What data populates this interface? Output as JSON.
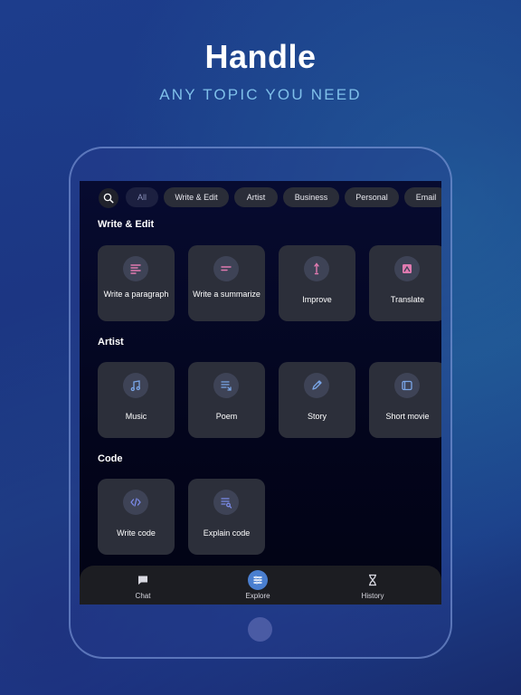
{
  "headline": "Handle",
  "subheadline": "ANY TOPIC YOU NEED",
  "chips": [
    "All",
    "Write & Edit",
    "Artist",
    "Business",
    "Personal",
    "Email"
  ],
  "sections": [
    {
      "title": "Write & Edit",
      "cards": [
        {
          "label": "Write a paragraph",
          "icon": "paragraph-icon"
        },
        {
          "label": "Write a summarize",
          "icon": "summary-icon"
        },
        {
          "label": "Improve",
          "icon": "pen-icon"
        },
        {
          "label": "Translate",
          "icon": "translate-icon"
        }
      ]
    },
    {
      "title": "Artist",
      "cards": [
        {
          "label": "Music",
          "icon": "music-icon"
        },
        {
          "label": "Poem",
          "icon": "poem-icon"
        },
        {
          "label": "Story",
          "icon": "pencil-icon"
        },
        {
          "label": "Short movie",
          "icon": "movie-icon"
        }
      ]
    },
    {
      "title": "Code",
      "cards": [
        {
          "label": "Write code",
          "icon": "code-icon"
        },
        {
          "label": "Explain code",
          "icon": "explain-icon"
        }
      ]
    }
  ],
  "nav": [
    {
      "label": "Chat",
      "icon": "chat-icon"
    },
    {
      "label": "Explore",
      "icon": "explore-icon",
      "active": true
    },
    {
      "label": "History",
      "icon": "hourglass-icon"
    }
  ],
  "colors": {
    "accent": "#4a7fd0",
    "icon_pink": "#e07ab0",
    "icon_blue": "#7aa6e8",
    "subhead": "#7fc0ea"
  }
}
